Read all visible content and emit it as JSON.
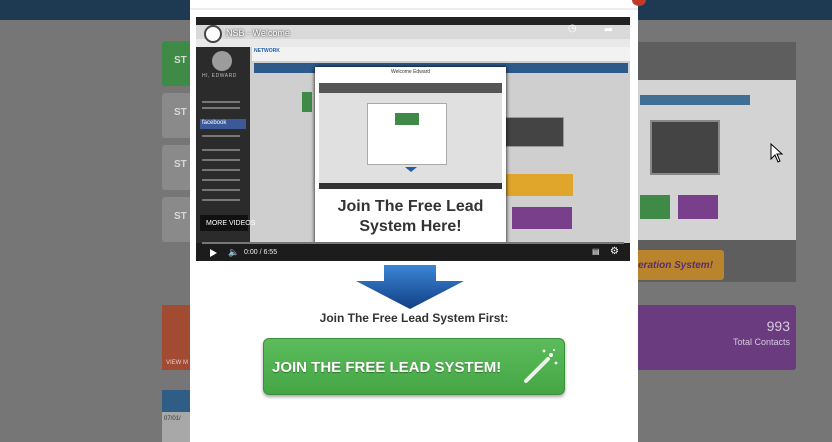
{
  "video": {
    "title": "NSB - Welcome",
    "time": "0:00 / 6:55",
    "more_videos": "MORE VIDEOS",
    "sidebar_name": "HI, EDWARD",
    "facebook_label": "facebook",
    "network_logo": "NETWORK",
    "popup_title": "Welcome Edward",
    "popup_text": "Join The Free Lead System Here!"
  },
  "modal": {
    "subtitle": "Join The Free Lead System First:",
    "cta_label": "JOIN THE FREE LEAD SYSTEM!"
  },
  "background": {
    "tile_prefix": "ST",
    "tile_red_label": "VIEW M",
    "date_fragment": "07/01/",
    "orange_button_label": "eration System!",
    "contacts_count": "993",
    "contacts_label": "Total Contacts"
  },
  "colors": {
    "cta_green": "#4caf50",
    "arrow_blue": "#1f5fa8",
    "topbar": "#1e3a52",
    "purple_card": "#6a3b7e"
  },
  "icons": {
    "play": "play-icon",
    "volume": "volume-icon",
    "settings": "gear-icon",
    "captions": "captions-icon",
    "share": "share-icon",
    "watch_later": "clock-icon",
    "wand": "magic-wand-icon",
    "down_arrow": "down-arrow-icon"
  }
}
